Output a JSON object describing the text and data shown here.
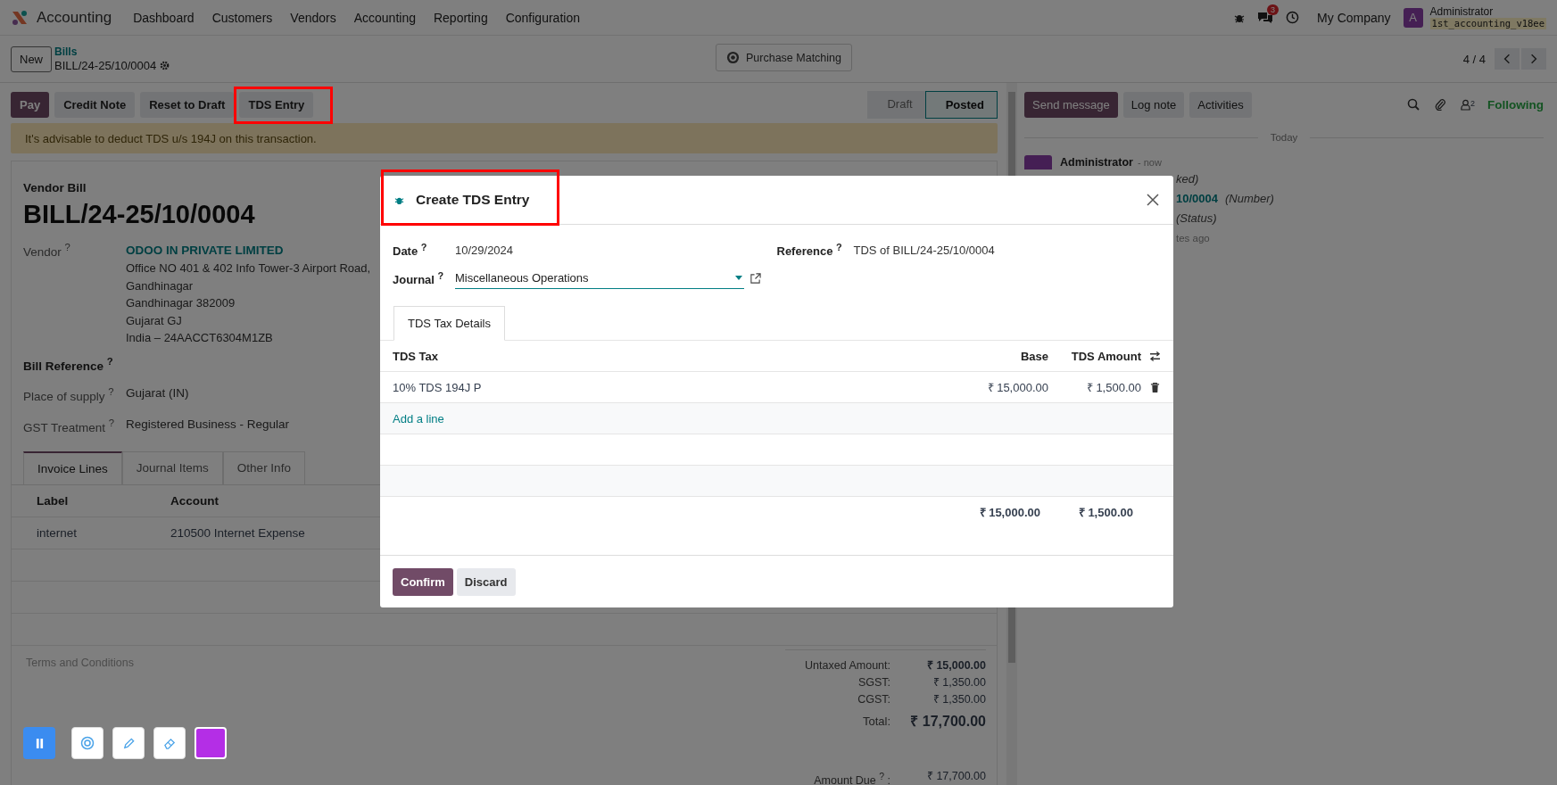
{
  "navbar": {
    "app": "Accounting",
    "menu": [
      "Dashboard",
      "Customers",
      "Vendors",
      "Accounting",
      "Reporting",
      "Configuration"
    ],
    "chat_badge": "3",
    "company": "My Company",
    "user_initial": "A",
    "user_name": "Administrator",
    "database": "1st_accounting_v18ee"
  },
  "control_panel": {
    "new": "New",
    "breadcrumb_parent": "Bills",
    "breadcrumb_current": "BILL/24-25/10/0004",
    "center_button": "Purchase Matching",
    "pager": "4 / 4"
  },
  "actions": [
    {
      "label": "Pay",
      "kind": "primary",
      "highlighted": false
    },
    {
      "label": "Credit Note",
      "kind": "secondary",
      "highlighted": false
    },
    {
      "label": "Reset to Draft",
      "kind": "secondary",
      "highlighted": false
    },
    {
      "label": "TDS Entry",
      "kind": "secondary",
      "highlighted": true
    }
  ],
  "status_steps": [
    {
      "label": "Draft",
      "selected": false
    },
    {
      "label": "Posted",
      "selected": true
    }
  ],
  "alert": "It's advisable to deduct TDS u/s 194J on this transaction.",
  "bill": {
    "kind_label": "Vendor Bill",
    "number": "BILL/24-25/10/0004",
    "vendor_label": "Vendor $^{?}$",
    "vendor_name": "ODOO IN PRIVATE LIMITED",
    "address_lines": [
      "Office NO 401 & 402 Info Tower-3 Airport Road,",
      "Gandhinagar",
      "Gandhinagar 382009",
      "Gujarat GJ",
      "India – 24AACCT6304M1ZB"
    ],
    "bill_reference_label": "Bill Reference $^{?}$",
    "fields": [
      {
        "label": "Place of supply $^{?}$",
        "value": "Gujarat (IN)"
      },
      {
        "label": "GST Treatment $^{?}$",
        "value": "Registered Business - Regular"
      }
    ]
  },
  "tabs": [
    {
      "label": "Invoice Lines",
      "selected": true
    },
    {
      "label": "Journal Items",
      "selected": false
    },
    {
      "label": "Other Info",
      "selected": false
    }
  ],
  "lines_table": {
    "columns": [
      "Label",
      "Account"
    ],
    "rows": [
      [
        "internet",
        "210500 Internet Expense"
      ]
    ]
  },
  "terms_placeholder": "Terms and Conditions",
  "totals": [
    {
      "label": "Untaxed Amount:",
      "value": "₹ 15,000.00",
      "kind": "subtotal"
    },
    {
      "label": "SGST:",
      "value": "₹ 1,350.00",
      "kind": "tax"
    },
    {
      "label": "CGST:",
      "value": "₹ 1,350.00",
      "kind": "tax"
    },
    {
      "label": "Total:",
      "value": "₹ 17,700.00",
      "kind": "total"
    }
  ],
  "amount_due": {
    "label": "Amount Due $^{?}$ :",
    "value": "₹ 17,700.00"
  },
  "chatter": {
    "buttons": [
      {
        "label": "Send message",
        "selected": true
      },
      {
        "label": "Log note",
        "selected": false
      },
      {
        "label": "Activities",
        "selected": false
      }
    ],
    "follower_count": "2",
    "follow_label": "Following",
    "date_separator": "Today",
    "author": "Administrator",
    "time": "- now",
    "lines": [
      [
        {
          "text": "ked)",
          "kind": "note"
        }
      ],
      [
        {
          "text": "10/0004",
          "kind": "link"
        },
        {
          "text": "(Number)",
          "kind": "note"
        }
      ],
      [
        {
          "text": "(Status)",
          "kind": "note"
        }
      ],
      [
        {
          "text": "tes ago",
          "kind": "muted"
        }
      ]
    ]
  },
  "dialog": {
    "title": "Create TDS Entry",
    "title_highlighted": true,
    "date_label": "Date $^{?}$",
    "date": "10/29/2024",
    "journal_label": "Journal $^{?}$",
    "journal": "Miscellaneous Operations",
    "reference_label": "Reference $^{?}$",
    "reference": "TDS of BILL/24-25/10/0004",
    "tabs": [
      {
        "label": "TDS Tax Details",
        "selected": true
      }
    ],
    "columns": [
      "TDS Tax",
      "Base",
      "TDS Amount"
    ],
    "rows": [
      [
        "10% TDS 194J P",
        "₹ 15,000.00",
        "₹ 1,500.00"
      ]
    ],
    "add_line": "Add a line",
    "totals": [
      "₹ 15,000.00",
      "₹ 1,500.00"
    ],
    "buttons": [
      {
        "label": "Confirm",
        "kind": "primary"
      },
      {
        "label": "Discard",
        "kind": "secondary"
      }
    ]
  }
}
